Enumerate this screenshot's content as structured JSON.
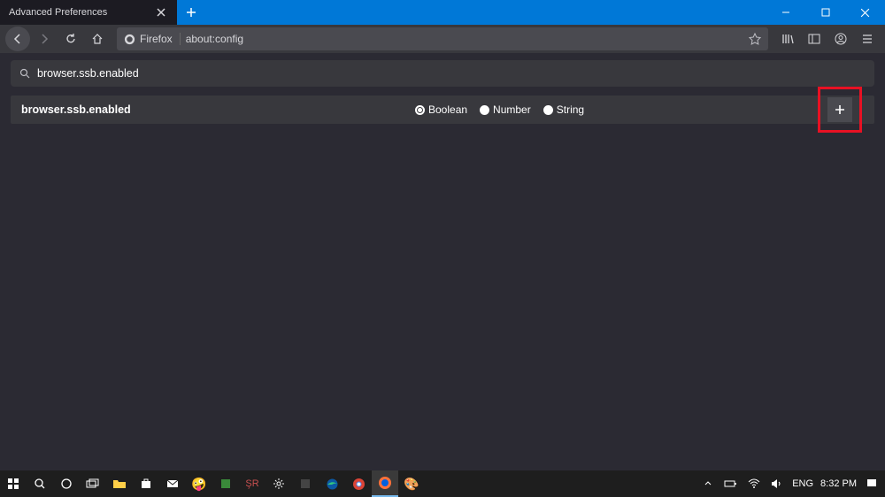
{
  "titlebar": {
    "tab_title": "Advanced Preferences"
  },
  "navbar": {
    "identity_label": "Firefox",
    "url": "about:config"
  },
  "search": {
    "value": "browser.ssb.enabled"
  },
  "preference": {
    "name": "browser.ssb.enabled",
    "types": {
      "boolean": "Boolean",
      "number": "Number",
      "string": "String"
    },
    "selected_type": "boolean"
  },
  "systray": {
    "lang": "ENG",
    "time": "8:32 PM"
  }
}
